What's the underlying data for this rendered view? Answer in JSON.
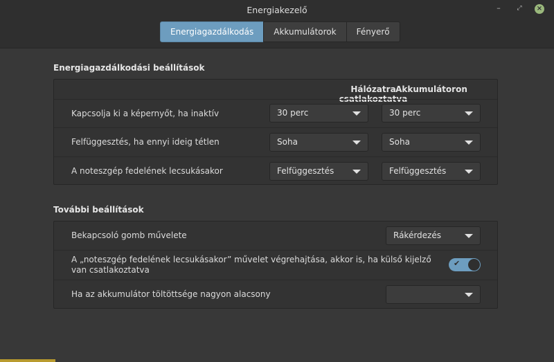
{
  "window": {
    "title": "Energiakezelő",
    "controls": {
      "minimize": "–",
      "maximize": "⤢",
      "close": "×"
    }
  },
  "tabs": [
    {
      "label": "Energiagazdálkodás",
      "active": true
    },
    {
      "label": "Akkumulátorok",
      "active": false
    },
    {
      "label": "Fényerő",
      "active": false
    }
  ],
  "power_settings": {
    "title": "Energiagazdálkodási beállítások",
    "col_ac": "Hálózatra csatlakoztatva",
    "col_battery": "Akkumulátoron",
    "rows": [
      {
        "label": "Kapcsolja ki a képernyőt, ha inaktív",
        "ac": "30 perc",
        "battery": "30 perc"
      },
      {
        "label": "Felfüggesztés, ha ennyi ideig tétlen",
        "ac": "Soha",
        "battery": "Soha"
      },
      {
        "label": "A noteszgép fedelének lecsukásakor",
        "ac": "Felfüggesztés",
        "battery": "Felfüggesztés"
      }
    ]
  },
  "extra_settings": {
    "title": "További beállítások",
    "power_button_label": "Bekapcsoló gomb művelete",
    "power_button_value": "Rákérdezés",
    "lid_external_label": "A „noteszgép fedelének lecsukásakor” művelet végrehajtása, akkor is, ha külső kijelző van csatlakoztatva",
    "lid_external_enabled": true,
    "lid_external_check": "✔",
    "critical_battery_label": "Ha az akkumulátor töltöttsége nagyon alacsony",
    "critical_battery_value": ""
  },
  "colors": {
    "accent": "#6d9dbf",
    "background": "#383838",
    "titlebar": "#2f2f2f",
    "close_button": "#9ab87c"
  }
}
